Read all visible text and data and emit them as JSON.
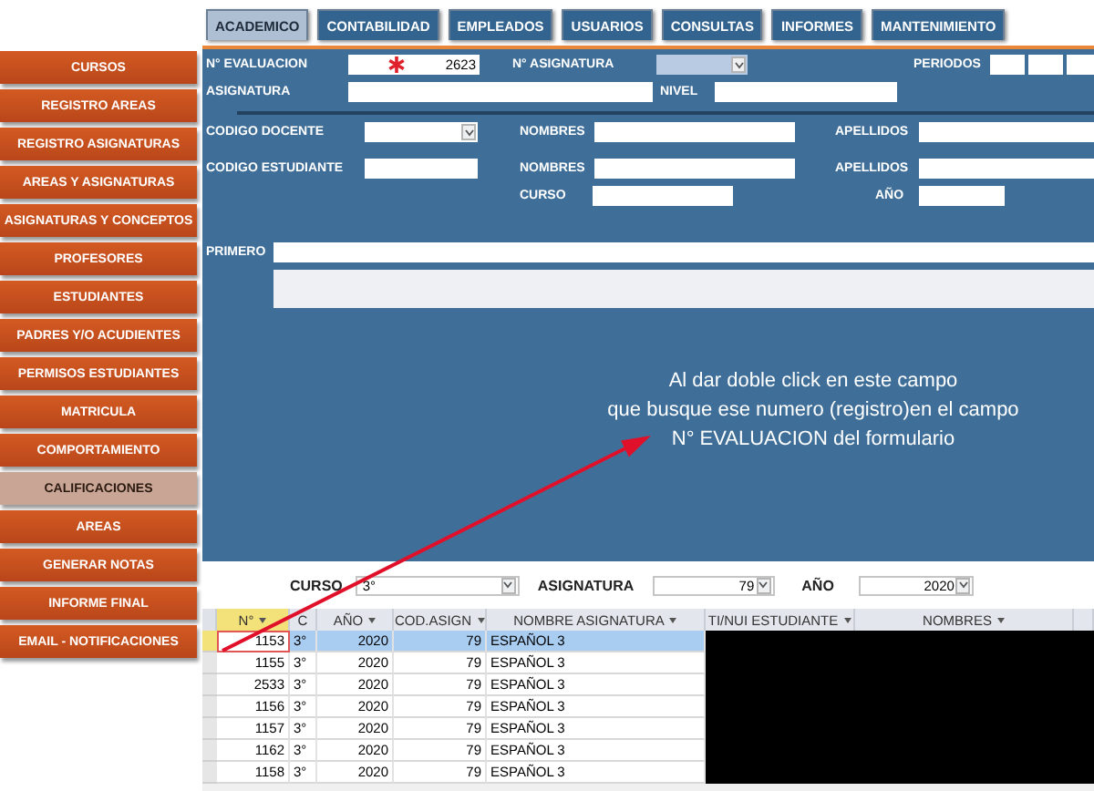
{
  "tabs": [
    {
      "label": "ACADEMICO",
      "selected": true
    },
    {
      "label": "CONTABILIDAD",
      "selected": false
    },
    {
      "label": "EMPLEADOS",
      "selected": false
    },
    {
      "label": "USUARIOS",
      "selected": false
    },
    {
      "label": "CONSULTAS",
      "selected": false
    },
    {
      "label": "INFORMES",
      "selected": false
    },
    {
      "label": "MANTENIMIENTO",
      "selected": false
    }
  ],
  "sidebar": {
    "items": [
      {
        "label": "CURSOS",
        "selected": false
      },
      {
        "label": "REGISTRO AREAS",
        "selected": false
      },
      {
        "label": "REGISTRO ASIGNATURAS",
        "selected": false
      },
      {
        "label": "AREAS Y ASIGNATURAS",
        "selected": false
      },
      {
        "label": "ASIGNATURAS Y CONCEPTOS",
        "selected": false
      },
      {
        "label": "PROFESORES",
        "selected": false
      },
      {
        "label": "ESTUDIANTES",
        "selected": false
      },
      {
        "label": "PADRES Y/O ACUDIENTES",
        "selected": false
      },
      {
        "label": "PERMISOS ESTUDIANTES",
        "selected": false
      },
      {
        "label": "MATRICULA",
        "selected": false
      },
      {
        "label": "COMPORTAMIENTO",
        "selected": false
      },
      {
        "label": "CALIFICACIONES",
        "selected": true
      },
      {
        "label": "AREAS",
        "selected": false
      },
      {
        "label": "GENERAR NOTAS",
        "selected": false
      },
      {
        "label": "INFORME FINAL",
        "selected": false
      },
      {
        "label": "EMAIL - NOTIFICACIONES",
        "selected": false
      }
    ]
  },
  "form": {
    "evaluacion": {
      "label": "N° EVALUACION",
      "value": "2623"
    },
    "numero_asignatura": {
      "label": "N° ASIGNATURA"
    },
    "periodos": {
      "label": "PERIODOS"
    },
    "asignatura": {
      "label": "ASIGNATURA"
    },
    "nivel": {
      "label": "NIVEL"
    },
    "codigo_docente": {
      "label": "CODIGO DOCENTE"
    },
    "nombres_docente": {
      "label": "NOMBRES"
    },
    "apellidos_docente": {
      "label": "APELLIDOS"
    },
    "codigo_estudiante": {
      "label": "CODIGO ESTUDIANTE"
    },
    "nombres_estudiante": {
      "label": "NOMBRES"
    },
    "apellidos_estudiante": {
      "label": "APELLIDOS"
    },
    "curso": {
      "label": "CURSO"
    },
    "anio": {
      "label": "AÑO"
    },
    "primero": {
      "label": "PRIMERO"
    }
  },
  "annotation": "Al dar doble click en este campo\nque busque ese numero (registro)en el campo\nN° EVALUACION del formulario",
  "filters": [
    {
      "label": "CURSO",
      "value": "3°"
    },
    {
      "label": "ASIGNATURA",
      "value": "79"
    },
    {
      "label": "AÑO",
      "value": "2020"
    }
  ],
  "table": {
    "columns": [
      "N°",
      "C",
      "AÑO",
      "COD.ASIGN",
      "NOMBRE ASIGNATURA",
      "TI/NUI ESTUDIANTE",
      "NOMBRES"
    ],
    "rows": [
      {
        "cells": [
          "1153",
          "3°",
          "2020",
          "79",
          "ESPAÑOL 3"
        ],
        "selected": true
      },
      {
        "cells": [
          "1155",
          "3°",
          "2020",
          "79",
          "ESPAÑOL 3"
        ],
        "selected": false
      },
      {
        "cells": [
          "2533",
          "3°",
          "2020",
          "79",
          "ESPAÑOL 3"
        ],
        "selected": false
      },
      {
        "cells": [
          "1156",
          "3°",
          "2020",
          "79",
          "ESPAÑOL 3"
        ],
        "selected": false
      },
      {
        "cells": [
          "1157",
          "3°",
          "2020",
          "79",
          "ESPAÑOL 3"
        ],
        "selected": false
      },
      {
        "cells": [
          "1162",
          "3°",
          "2020",
          "79",
          "ESPAÑOL 3"
        ],
        "selected": false
      },
      {
        "cells": [
          "1158",
          "3°",
          "2020",
          "79",
          "ESPAÑOL 3"
        ],
        "selected": false
      }
    ]
  }
}
